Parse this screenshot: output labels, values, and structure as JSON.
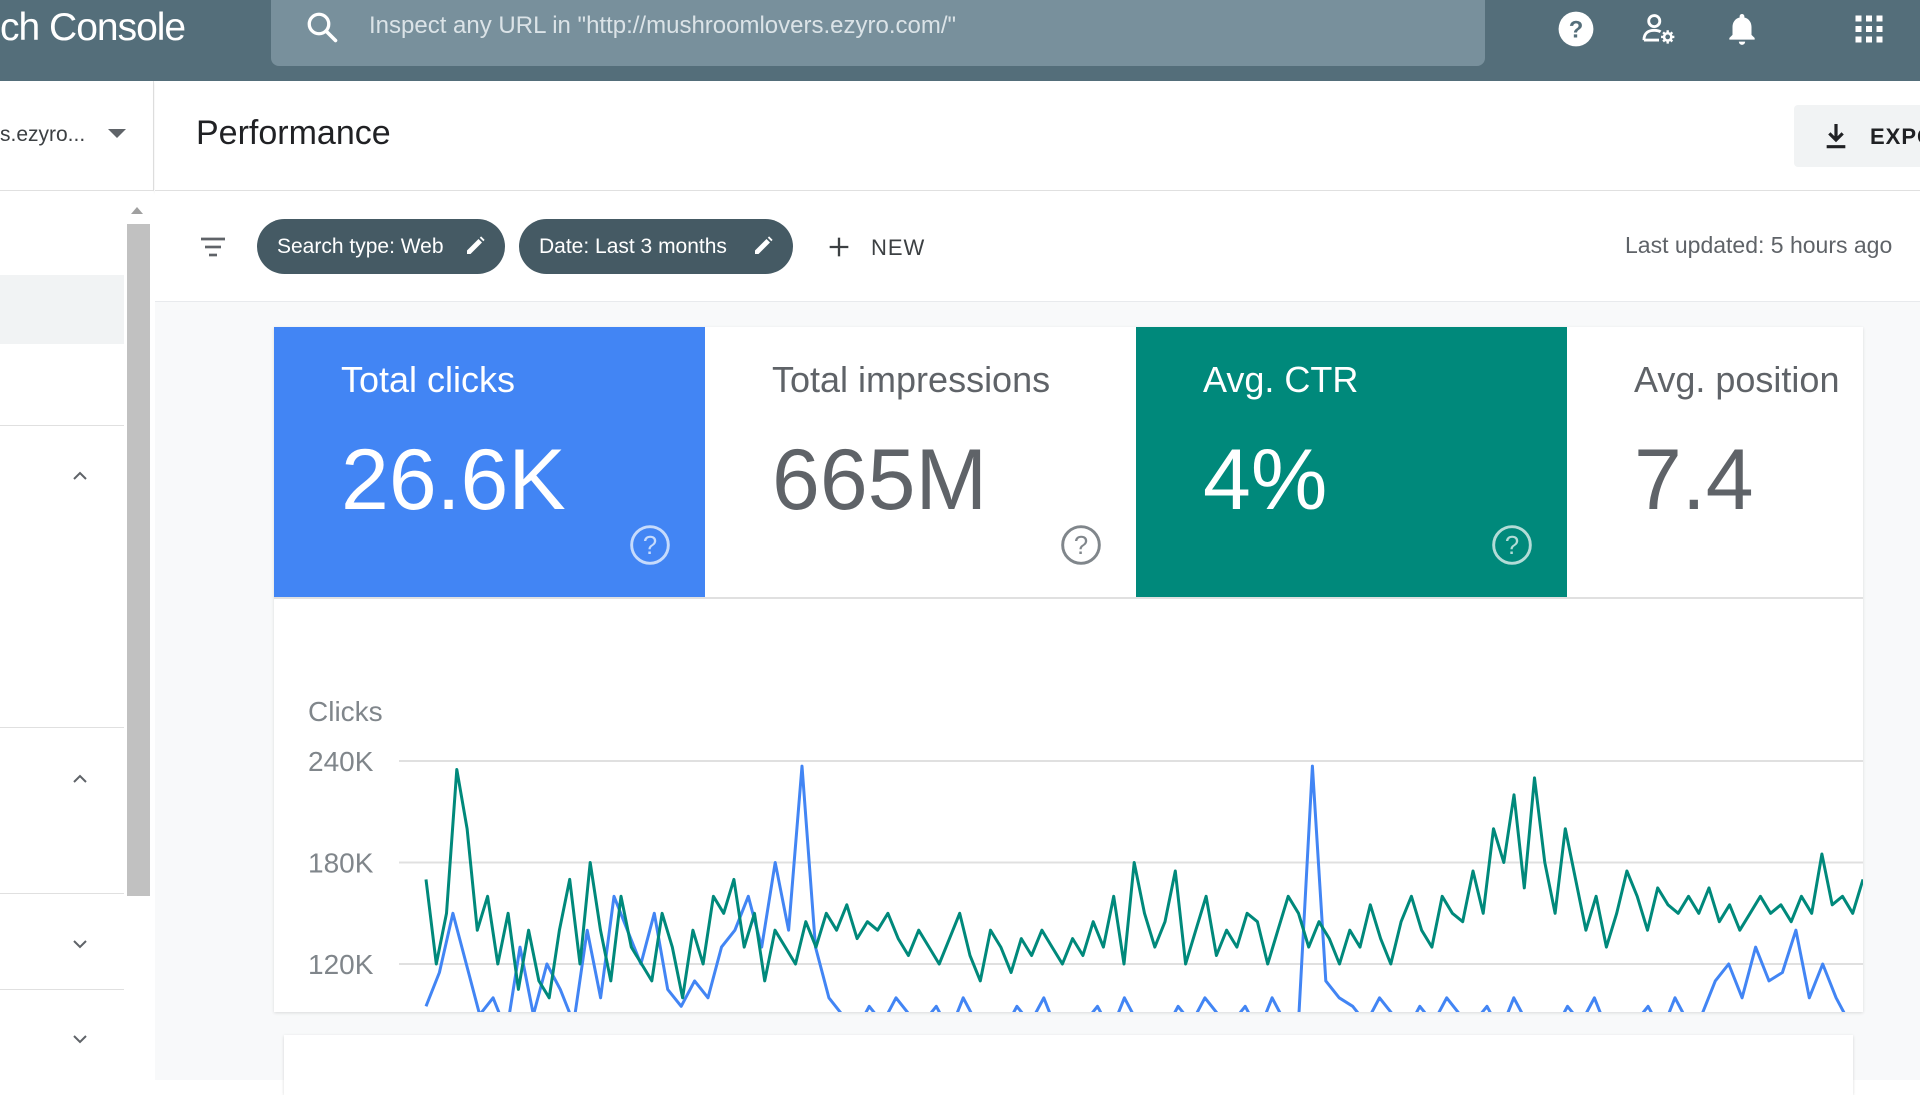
{
  "topbar": {
    "app_title": "ch Console",
    "search_placeholder": "Inspect any URL in \"http://mushroomlovers.ezyro.com/\"",
    "icons": [
      "search-icon",
      "help-icon",
      "manage-users-icon",
      "notifications-icon",
      "apps-icon"
    ],
    "background": "#546e7a"
  },
  "sidebar": {
    "property_text": "s.ezyro..."
  },
  "page": {
    "title": "Performance",
    "export_label": "EXPO"
  },
  "filters": {
    "chips": [
      {
        "label": "Search type: Web"
      },
      {
        "label": "Date: Last 3 months"
      }
    ],
    "new_label": "NEW",
    "last_updated": "Last updated: 5 hours ago"
  },
  "metrics": [
    {
      "label": "Total clicks",
      "value": "26.6K",
      "selected": true,
      "color": "#4285f4"
    },
    {
      "label": "Total impressions",
      "value": "665M",
      "selected": false,
      "color": "#5e35b1"
    },
    {
      "label": "Avg. CTR",
      "value": "4%",
      "selected": true,
      "color": "#00897b"
    },
    {
      "label": "Avg. position",
      "value": "7.4",
      "selected": false,
      "color": "#e8710a"
    }
  ],
  "chart_data": {
    "type": "line",
    "ylabel": "Clicks",
    "yticks": [
      "240K",
      "180K",
      "120K"
    ],
    "tick_values": [
      240000,
      180000,
      120000
    ],
    "series": [
      {
        "color": "#4285f4",
        "values": [
          95000,
          115000,
          150000,
          120000,
          90000,
          100000,
          80000,
          130000,
          90000,
          120000,
          105000,
          85000,
          140000,
          100000,
          160000,
          140000,
          120000,
          150000,
          105000,
          95000,
          110000,
          100000,
          130000,
          140000,
          160000,
          130000,
          180000,
          140000,
          237000,
          130000,
          100000,
          90000,
          80000,
          95000,
          85000,
          100000,
          90000,
          85000,
          95000,
          80000,
          100000,
          85000,
          90000,
          80000,
          95000,
          85000,
          100000,
          80000,
          90000,
          85000,
          95000,
          80000,
          100000,
          85000,
          90000,
          80000,
          95000,
          85000,
          100000,
          90000,
          85000,
          95000,
          80000,
          100000,
          85000,
          90000,
          237000,
          110000,
          100000,
          95000,
          85000,
          100000,
          90000,
          80000,
          95000,
          85000,
          100000,
          90000,
          85000,
          95000,
          80000,
          100000,
          85000,
          90000,
          80000,
          95000,
          85000,
          100000,
          80000,
          90000,
          85000,
          95000,
          80000,
          100000,
          85000,
          90000,
          110000,
          120000,
          100000,
          130000,
          110000,
          115000,
          140000,
          100000,
          120000,
          100000,
          85000,
          90000
        ]
      },
      {
        "color": "#00897b",
        "values": [
          170000,
          120000,
          150000,
          235000,
          200000,
          140000,
          160000,
          120000,
          150000,
          105000,
          140000,
          110000,
          100000,
          140000,
          170000,
          120000,
          180000,
          140000,
          110000,
          160000,
          130000,
          120000,
          110000,
          150000,
          130000,
          100000,
          140000,
          120000,
          160000,
          150000,
          170000,
          130000,
          150000,
          110000,
          140000,
          130000,
          120000,
          145000,
          130000,
          150000,
          140000,
          155000,
          135000,
          145000,
          140000,
          150000,
          135000,
          125000,
          140000,
          130000,
          120000,
          135000,
          150000,
          125000,
          110000,
          140000,
          130000,
          115000,
          135000,
          125000,
          140000,
          130000,
          120000,
          135000,
          125000,
          145000,
          130000,
          160000,
          120000,
          180000,
          150000,
          130000,
          145000,
          175000,
          120000,
          140000,
          160000,
          125000,
          140000,
          130000,
          150000,
          145000,
          120000,
          140000,
          160000,
          150000,
          130000,
          145000,
          135000,
          120000,
          140000,
          130000,
          155000,
          135000,
          120000,
          145000,
          160000,
          140000,
          130000,
          160000,
          150000,
          145000,
          175000,
          150000,
          200000,
          180000,
          220000,
          165000,
          230000,
          180000,
          150000,
          200000,
          170000,
          140000,
          160000,
          130000,
          150000,
          175000,
          160000,
          140000,
          165000,
          155000,
          150000,
          160000,
          150000,
          165000,
          145000,
          155000,
          140000,
          150000,
          160000,
          150000,
          155000,
          145000,
          160000,
          150000,
          185000,
          155000,
          160000,
          150000,
          170000
        ]
      }
    ]
  }
}
